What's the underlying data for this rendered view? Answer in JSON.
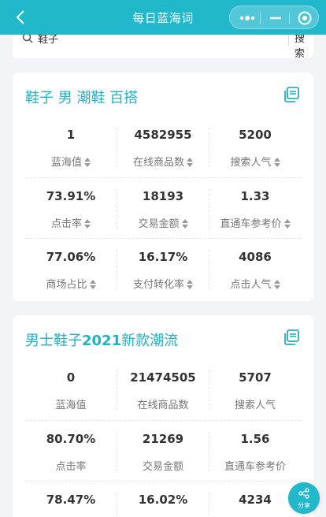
{
  "nav": {
    "title": "每日蓝海词"
  },
  "search": {
    "value": "鞋子",
    "button_label": "搜索"
  },
  "cards": [
    {
      "title": "鞋子 男 潮鞋 百搭",
      "metrics": [
        [
          {
            "value": "1",
            "label": "蓝海值",
            "sortable": true
          },
          {
            "value": "4582955",
            "label": "在线商品数",
            "sortable": true
          },
          {
            "value": "5200",
            "label": "搜索人气",
            "sortable": true
          }
        ],
        [
          {
            "value": "73.91%",
            "label": "点击率",
            "sortable": true
          },
          {
            "value": "18193",
            "label": "交易金额",
            "sortable": true
          },
          {
            "value": "1.33",
            "label": "直通车参考价",
            "sortable": true
          }
        ],
        [
          {
            "value": "77.06%",
            "label": "商场占比",
            "sortable": true
          },
          {
            "value": "16.17%",
            "label": "支付转化率",
            "sortable": true
          },
          {
            "value": "4086",
            "label": "点击人气",
            "sortable": true
          }
        ]
      ]
    },
    {
      "title_plain_1": "男士鞋子",
      "title_bold": "2021",
      "title_plain_2": "新款潮流",
      "metrics": [
        [
          {
            "value": "0",
            "label": "蓝海值",
            "sortable": false
          },
          {
            "value": "21474505",
            "label": "在线商品数",
            "sortable": false
          },
          {
            "value": "5707",
            "label": "搜索人气",
            "sortable": false
          }
        ],
        [
          {
            "value": "80.70%",
            "label": "点击率",
            "sortable": false
          },
          {
            "value": "21269",
            "label": "交易金额",
            "sortable": false
          },
          {
            "value": "1.56",
            "label": "直通车参考价",
            "sortable": false
          }
        ],
        [
          {
            "value": "78.47%",
            "label": "",
            "sortable": false
          },
          {
            "value": "16.02%",
            "label": "",
            "sortable": false
          },
          {
            "value": "4234",
            "label": "",
            "sortable": false
          }
        ]
      ]
    }
  ],
  "share": {
    "label": "分享"
  },
  "colors": {
    "accent": "#22b8cc",
    "title": "#22b0c4",
    "background": "#f2f4f7"
  },
  "icons": [
    "back-icon",
    "more-icon",
    "minimize-icon",
    "close-target-icon",
    "search-icon",
    "copy-icon",
    "sort-icon",
    "share-icon"
  ]
}
